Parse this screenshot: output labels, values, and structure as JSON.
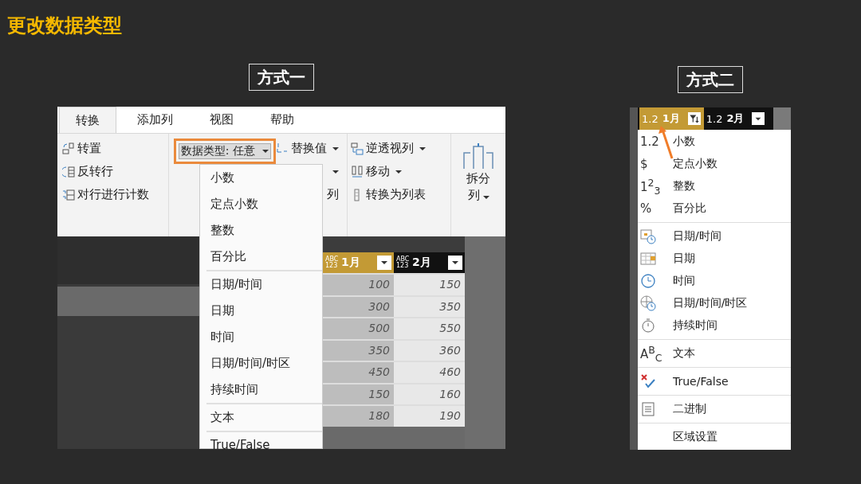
{
  "slide_title": "更改数据类型",
  "method_one": {
    "label": "方式一",
    "tabs": [
      {
        "label": "转换",
        "selected": true
      },
      {
        "label": "添加列",
        "selected": false
      },
      {
        "label": "视图",
        "selected": false
      },
      {
        "label": "帮助",
        "selected": false
      }
    ],
    "table_group": [
      {
        "label": "转置",
        "kind": "transpose"
      },
      {
        "label": "反转行",
        "kind": "reverse"
      },
      {
        "label": "对行进行计数",
        "kind": "count"
      }
    ],
    "data_type_button": {
      "label": "数据类型: 任意",
      "highlighted": true
    },
    "replace_column": [
      {
        "label": "替换值",
        "menu": true,
        "kind": "replace"
      },
      {
        "menu": true
      },
      {
        "label": "列",
        "menu": false
      }
    ],
    "any_column_group": [
      {
        "label": "逆透视列",
        "menu": true,
        "kind": "unpivot"
      },
      {
        "label": "移动",
        "menu": true,
        "kind": "move"
      },
      {
        "label": "转换为列表",
        "menu": false,
        "kind": "list"
      }
    ],
    "split_button": {
      "label": "拆分",
      "label2": "列",
      "menu": true
    },
    "table": {
      "columns": [
        {
          "type": "ABC 123",
          "name": "1月",
          "selected": true
        },
        {
          "type": "ABC 123",
          "name": "2月",
          "selected": false
        }
      ],
      "rows": [
        [
          "100",
          "150"
        ],
        [
          "300",
          "350"
        ],
        [
          "500",
          "550"
        ],
        [
          "350",
          "360"
        ],
        [
          "450",
          "460"
        ],
        [
          "150",
          "160"
        ],
        [
          "180",
          "190"
        ]
      ]
    },
    "menu_groups": [
      [
        "小数",
        "定点小数",
        "整数",
        "百分比"
      ],
      [
        "日期/时间",
        "日期",
        "时间",
        "日期/时间/时区",
        "持续时间"
      ],
      [
        "文本"
      ],
      [
        "True/False"
      ]
    ]
  },
  "method_two": {
    "label": "方式二",
    "columns": [
      {
        "type": "1.2",
        "name": "1月",
        "selected": true,
        "filtered": true
      },
      {
        "type": "1.2",
        "name": "2月",
        "selected": false,
        "filtered": false
      }
    ],
    "menu_groups": [
      [
        {
          "label": "小数",
          "kind": "glyph",
          "glyph": "1.2"
        },
        {
          "label": "定点小数",
          "kind": "glyph",
          "glyph": "$"
        },
        {
          "label": "整数",
          "kind": "glyph",
          "glyph": "1$^{2}$$_{3}$"
        },
        {
          "label": "百分比",
          "kind": "glyph",
          "glyph": "%"
        }
      ],
      [
        {
          "label": "日期/时间",
          "kind": "datetime"
        },
        {
          "label": "日期",
          "kind": "date"
        },
        {
          "label": "时间",
          "kind": "time"
        },
        {
          "label": "日期/时间/时区",
          "kind": "timezone"
        },
        {
          "label": "持续时间",
          "kind": "duration"
        }
      ],
      [
        {
          "label": "文本",
          "kind": "glyph",
          "glyph": "A$^{B}$$_{C}$"
        }
      ],
      [
        {
          "label": "True/False",
          "kind": "truefalse"
        }
      ],
      [
        {
          "label": "二进制",
          "kind": "binary"
        }
      ],
      [
        {
          "label": "区域设置",
          "kind": "none"
        }
      ]
    ]
  }
}
